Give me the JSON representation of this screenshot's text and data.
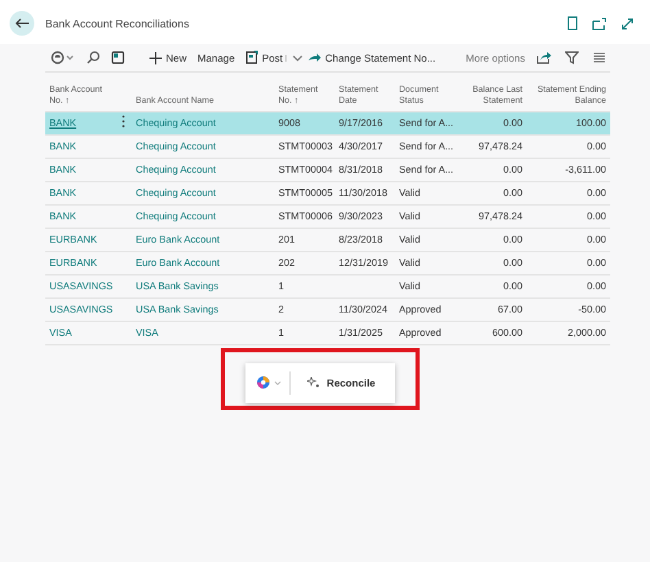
{
  "window": {
    "title": "Bank Account Reconciliations"
  },
  "toolbar": {
    "items": [
      {
        "kind": "icon"
      },
      {
        "kind": "icon"
      },
      {
        "kind": "icon"
      },
      {
        "kind": "divider"
      },
      {
        "kind": "button",
        "label": "New"
      },
      {
        "kind": "button",
        "label": "Manage"
      },
      {
        "kind": "split",
        "label": "Post"
      },
      {
        "kind": "button",
        "label": "Change Statement No..."
      },
      {
        "kind": "divider"
      },
      {
        "kind": "button",
        "label": "More options"
      }
    ]
  },
  "table": {
    "columns": [
      {
        "label": "Bank Account No. ↑"
      },
      {
        "label": "Bank Account Name"
      },
      {
        "label": "Statement No. ↑"
      },
      {
        "label": "Statement Date"
      },
      {
        "label": "Document Status"
      },
      {
        "label": "Balance Last Statement"
      },
      {
        "label": "Statement Ending Balance"
      }
    ],
    "rows": [
      {
        "selected": true,
        "cells": [
          "BANK",
          "Chequing Account",
          "9008",
          "9/17/2016",
          "Send for A...",
          "0.00",
          "100.00"
        ]
      },
      {
        "selected": false,
        "cells": [
          "BANK",
          "Chequing Account",
          "STMT00003",
          "4/30/2017",
          "Send for A...",
          "97,478.24",
          "0.00"
        ]
      },
      {
        "selected": false,
        "cells": [
          "BANK",
          "Chequing Account",
          "STMT00004",
          "8/31/2018",
          "Send for A...",
          "0.00",
          "-3,611.00"
        ]
      },
      {
        "selected": false,
        "cells": [
          "BANK",
          "Chequing Account",
          "STMT00005",
          "11/30/2018",
          "Valid",
          "0.00",
          "0.00"
        ]
      },
      {
        "selected": false,
        "cells": [
          "BANK",
          "Chequing Account",
          "STMT00006",
          "9/30/2023",
          "Valid",
          "97,478.24",
          "0.00"
        ]
      },
      {
        "selected": false,
        "cells": [
          "EURBANK",
          "Euro Bank Account",
          "201",
          "8/23/2018",
          "Valid",
          "0.00",
          "0.00"
        ]
      },
      {
        "selected": false,
        "cells": [
          "EURBANK",
          "Euro Bank Account",
          "202",
          "12/31/2019",
          "Valid",
          "0.00",
          "0.00"
        ]
      },
      {
        "selected": false,
        "cells": [
          "USASAVINGS",
          "USA Bank Savings",
          "1",
          "",
          "Valid",
          "0.00",
          "0.00"
        ]
      },
      {
        "selected": false,
        "cells": [
          "USASAVINGS",
          "USA Bank Savings",
          "2",
          "11/30/2024",
          "Approved",
          "67.00",
          "-50.00"
        ]
      },
      {
        "selected": false,
        "cells": [
          "VISA",
          "VISA",
          "1",
          "1/31/2025",
          "Approved",
          "600.00",
          "2,000.00"
        ]
      }
    ]
  },
  "popup": {
    "action": "Reconcile",
    "highlighted": true
  }
}
